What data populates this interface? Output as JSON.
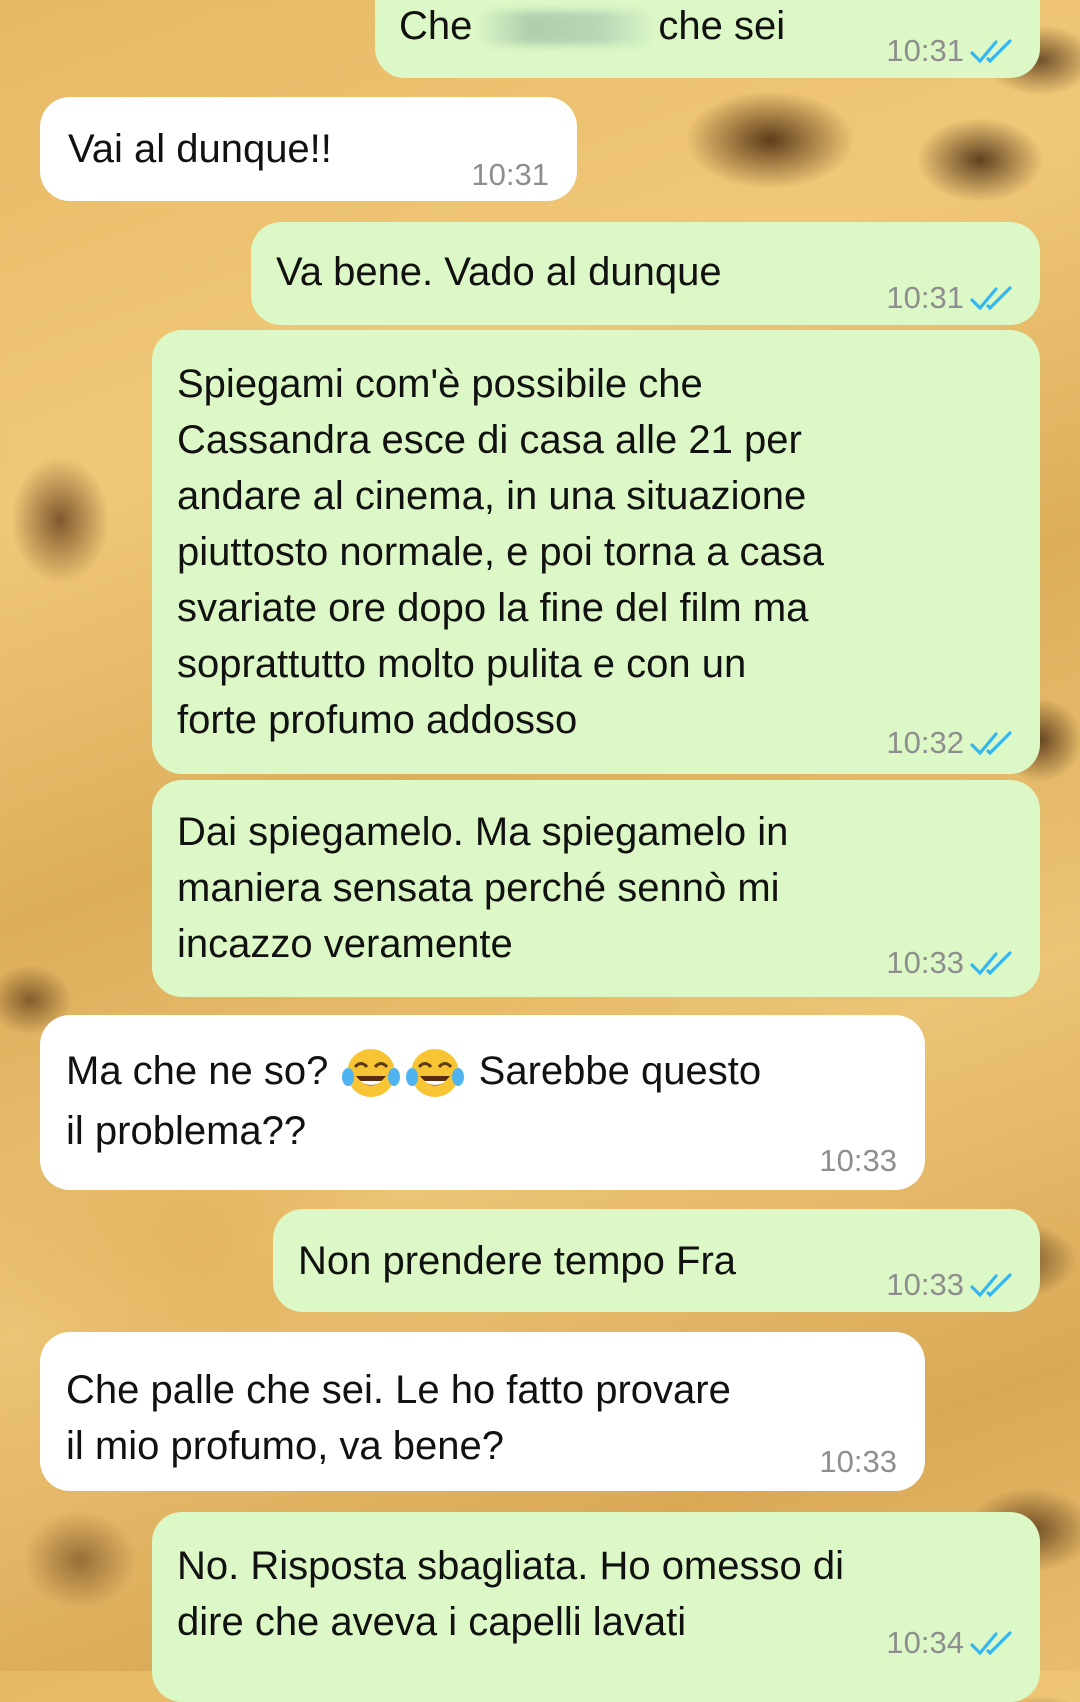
{
  "chat": {
    "messages": [
      {
        "id": "m1",
        "direction": "out",
        "text_before": "Che",
        "redacted": true,
        "text_after": "che sei",
        "time": "10:31",
        "status": "read"
      },
      {
        "id": "m2",
        "direction": "in",
        "text": "Vai al dunque!!",
        "time": "10:31"
      },
      {
        "id": "m3",
        "direction": "out",
        "text": "Va bene. Vado al dunque",
        "time": "10:31",
        "status": "read"
      },
      {
        "id": "m4",
        "direction": "out",
        "lines": [
          "Spiegami com'è possibile che",
          "Cassandra esce di casa alle 21 per",
          "andare al cinema, in una situazione",
          "piuttosto normale, e poi torna a casa",
          "svariate ore dopo la fine del film ma",
          "soprattutto molto pulita e con un",
          "forte profumo addosso"
        ],
        "time": "10:32",
        "status": "read"
      },
      {
        "id": "m5",
        "direction": "out",
        "lines": [
          "Dai spiegamelo. Ma spiegamelo in",
          "maniera sensata perché sennò mi",
          "incazzo veramente"
        ],
        "time": "10:33",
        "status": "read"
      },
      {
        "id": "m6",
        "direction": "in",
        "line1_before": "Ma che ne so?",
        "emoji": [
          "face-with-tears-of-joy",
          "face-with-tears-of-joy"
        ],
        "line1_after": "Sarebbe questo",
        "line2": "il problema??",
        "time": "10:33"
      },
      {
        "id": "m7",
        "direction": "out",
        "text": "Non prendere tempo Fra",
        "time": "10:33",
        "status": "read"
      },
      {
        "id": "m8",
        "direction": "in",
        "lines": [
          "Che palle che sei. Le ho fatto provare",
          "il mio profumo, va bene?"
        ],
        "time": "10:33"
      },
      {
        "id": "m9",
        "direction": "out",
        "lines": [
          "No. Risposta sbagliata. Ho omesso di",
          "dire che aveva i capelli lavati"
        ],
        "time": "10:34",
        "status": "read"
      }
    ]
  },
  "colors": {
    "outgoing_bubble": "#dcf8c6",
    "incoming_bubble": "#ffffff",
    "read_ticks": "#34b7f1",
    "timestamp": "#8e8e8e"
  },
  "icons": {
    "read_receipt": "double-check-icon",
    "emoji": "face-with-tears-of-joy"
  }
}
